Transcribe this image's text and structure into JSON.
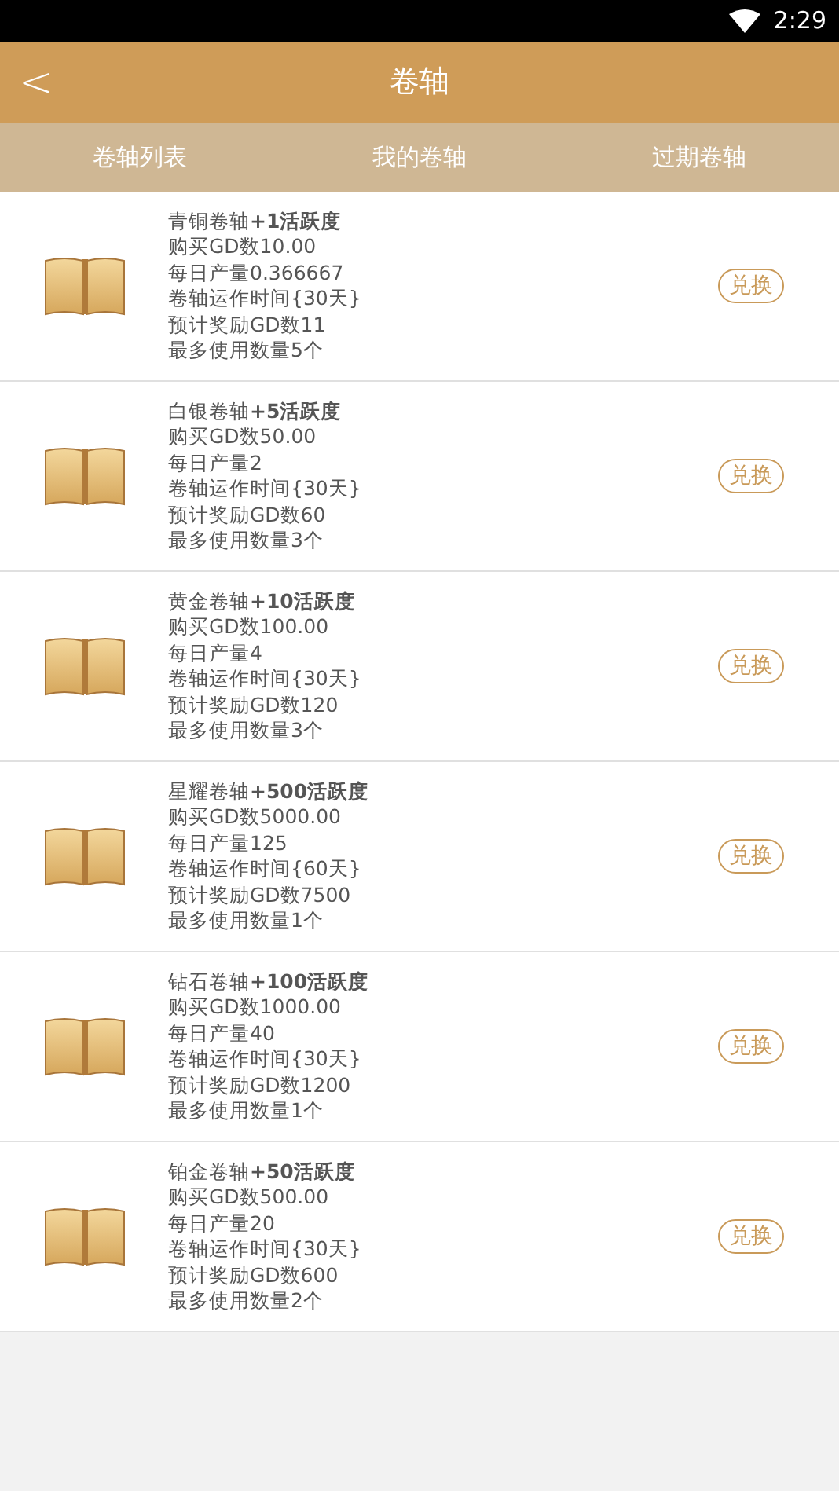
{
  "status_bar": {
    "time": "2:29"
  },
  "header": {
    "back": "<",
    "title": "卷轴"
  },
  "tabs": [
    {
      "label": "卷轴列表"
    },
    {
      "label": "我的卷轴"
    },
    {
      "label": "过期卷轴"
    }
  ],
  "scrolls": [
    {
      "title": "青铜卷轴**+1活跃度**",
      "lines": [
        "购买GD数10.00",
        "每日产量0.366667",
        "卷轴运作时间{30天}",
        "预计奖励GD数11",
        "最多使用数量5个"
      ],
      "button": "兑换"
    },
    {
      "title": "白银卷轴**+5活跃度**",
      "lines": [
        "购买GD数50.00",
        "每日产量2",
        "卷轴运作时间{30天}",
        "预计奖励GD数60",
        "最多使用数量3个"
      ],
      "button": "兑换"
    },
    {
      "title": "黄金卷轴**+10活跃度**",
      "lines": [
        "购买GD数100.00",
        "每日产量4",
        "卷轴运作时间{30天}",
        "预计奖励GD数120",
        "最多使用数量3个"
      ],
      "button": "兑换"
    },
    {
      "title": "星耀卷轴**+500活跃度**",
      "lines": [
        "购买GD数5000.00",
        "每日产量125",
        "卷轴运作时间{60天}",
        "预计奖励GD数7500",
        "最多使用数量1个"
      ],
      "button": "兑换"
    },
    {
      "title": "钻石卷轴**+100活跃度**",
      "lines": [
        "购买GD数1000.00",
        "每日产量40",
        "卷轴运作时间{30天}",
        "预计奖励GD数1200",
        "最多使用数量1个"
      ],
      "button": "兑换"
    },
    {
      "title": "铂金卷轴**+50活跃度**",
      "lines": [
        "购买GD数500.00",
        "每日产量20",
        "卷轴运作时间{30天}",
        "预计奖励GD数600",
        "最多使用数量2个"
      ],
      "button": "兑换"
    }
  ]
}
